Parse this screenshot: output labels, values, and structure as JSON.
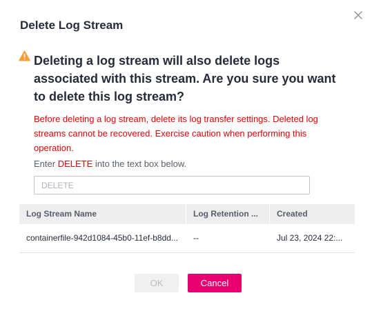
{
  "dialog": {
    "title": "Delete Log Stream",
    "question": "Deleting a log stream will also delete logs associated with this stream. Are you sure you want to delete this log stream?",
    "warning": "Before deleting a log stream, delete its log transfer settings. Deleted log streams cannot be recovered. Exercise caution when performing this operation.",
    "instruction_prefix": "Enter ",
    "instruction_keyword": "DELETE",
    "instruction_suffix": " into the text box below.",
    "input": {
      "value": "",
      "placeholder": "DELETE"
    }
  },
  "table": {
    "columns": [
      "Log Stream Name",
      "Log Retention ...",
      "Created"
    ],
    "rows": [
      [
        "containerfile-942d1084-45b0-11ef-b8dd...",
        "--",
        "Jul 23, 2024 22:..."
      ]
    ]
  },
  "buttons": {
    "ok": "OK",
    "cancel": "Cancel"
  },
  "icons": {
    "close": "close-icon",
    "warning": "warning-icon"
  },
  "colors": {
    "accent": "#e8006f",
    "danger": "#e60000",
    "warning_icon": "#f39e38"
  }
}
